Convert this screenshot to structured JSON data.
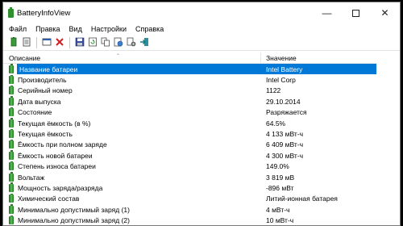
{
  "window": {
    "title": "BatteryInfoView"
  },
  "menu": [
    "Файл",
    "Правка",
    "Вид",
    "Настройки",
    "Справка"
  ],
  "toolbar": [
    {
      "name": "properties-icon"
    },
    {
      "name": "copy-list-icon"
    },
    {
      "sep": true
    },
    {
      "name": "window-icon"
    },
    {
      "name": "delete-icon"
    },
    {
      "sep": true
    },
    {
      "name": "save-icon"
    },
    {
      "name": "refresh-icon"
    },
    {
      "name": "copy-icon"
    },
    {
      "name": "html-report-icon"
    },
    {
      "name": "options-icon"
    },
    {
      "name": "exit-icon"
    }
  ],
  "columns": {
    "description": "Описание",
    "value": "Значение"
  },
  "rows": [
    {
      "label": "Название батареи",
      "value": "Intel Battery",
      "selected": true
    },
    {
      "label": "Производитель",
      "value": "Intel Corp"
    },
    {
      "label": "Серийный номер",
      "value": "1122"
    },
    {
      "label": "Дата выпуска",
      "value": "29.10.2014"
    },
    {
      "label": "Состояние",
      "value": "Разряжается"
    },
    {
      "label": "Текущая ёмкость (в %)",
      "value": "64.5%"
    },
    {
      "label": "Текущая ёмкость",
      "value": "4 133 мВт-ч"
    },
    {
      "label": "Ёмкость при полном заряде",
      "value": "6 409 мВт-ч"
    },
    {
      "label": "Ёмкость новой батареи",
      "value": "4 300 мВт-ч"
    },
    {
      "label": "Степень износа батареи",
      "value": "149.0%"
    },
    {
      "label": "Вольтаж",
      "value": "3 819 мВ"
    },
    {
      "label": "Мощность заряда/разряда",
      "value": "-896 мВт"
    },
    {
      "label": "Химический состав",
      "value": "Литий-ионная батарея"
    },
    {
      "label": "Минимально допустимый заряд (1)",
      "value": "4 мВт-ч"
    },
    {
      "label": "Минимально допустимый заряд (2)",
      "value": "10 мВт-ч"
    }
  ]
}
